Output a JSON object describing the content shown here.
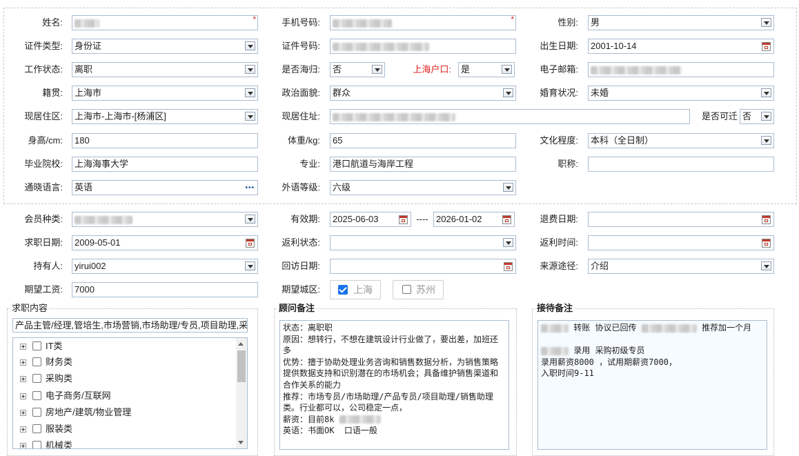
{
  "labels": {
    "name": "姓名:",
    "phone": "手机号码:",
    "gender": "性别:",
    "id_type": "证件类型:",
    "id_no": "证件号码:",
    "birthday": "出生日期:",
    "work_status": "工作状态:",
    "returnee": "是否海归:",
    "shanghai_hukou": "上海户口:",
    "email": "电子邮箱:",
    "native": "籍贯:",
    "political": "政治面貌:",
    "marital": "婚育状况:",
    "residence_area": "现居住区:",
    "residence_addr": "现居住址:",
    "relocate": "是否可迁",
    "height": "身高/cm:",
    "weight": "体重/kg:",
    "education": "文化程度:",
    "school": "毕业院校:",
    "major": "专业:",
    "title": "职称:",
    "language": "通晓语言:",
    "foreign_level": "外语等级:",
    "member_type": "会员种类:",
    "valid_period": "有效期:",
    "period_sep": "----",
    "refund_date": "退费日期:",
    "job_date": "求职日期:",
    "rebate_status": "返利状态:",
    "rebate_time": "返利时间:",
    "holder": "持有人:",
    "visit_date": "回访日期:",
    "source": "来源途径:",
    "expected_salary": "期望工资:",
    "expected_city": "期望城区:"
  },
  "values": {
    "name": "",
    "phone": "",
    "gender": "男",
    "id_type": "身份证",
    "id_no": "",
    "birthday": "2001-10-14",
    "work_status": "离职",
    "returnee": "否",
    "shanghai_hukou": "是",
    "email": "",
    "native": "上海市",
    "political": "群众",
    "marital": "未婚",
    "residence_area": "上海市-上海市-[杨浦区]",
    "residence_addr": "",
    "relocate": "否",
    "height": "180",
    "weight": "65",
    "education": "本科（全日制）",
    "school": "上海海事大学",
    "major": "港口航道与海岸工程",
    "title": "",
    "language": "英语",
    "foreign_level": "六级",
    "member_type": "",
    "valid_from": "2025-06-03",
    "valid_to": "2026-01-02",
    "refund_date": "",
    "job_date": "2009-05-01",
    "rebate_status": "",
    "rebate_time": "",
    "holder": "yirui002",
    "visit_date": "",
    "source": "介绍",
    "expected_salary": "7000"
  },
  "cities": [
    {
      "label": "上海",
      "checked": true
    },
    {
      "label": "苏州",
      "checked": false
    }
  ],
  "job_content": {
    "title": "求职内容",
    "summary": "产品主管/经理,管培生,市场营销,市场助理/专员,项目助理,采购",
    "tree": [
      "IT类",
      "财务类",
      "采购类",
      "电子商务/互联网",
      "房地产/建筑/物业管理",
      "服装类",
      "机械类"
    ]
  },
  "consultant_note": {
    "title": "顾问备注",
    "lines": [
      "状态：离职职",
      "原因：想转行，不想在建筑设计行业做了，要出差，加班还多",
      "优势：擅于协助处理业务咨询和销售数据分析，为销售策略提供数据支持和识别潜在的市场机会；具备维护销售渠道和合作关系的能力",
      "推荐：市场专员/市场助理/产品专员/项目助理/销售助理类。行业都可以，公司稳定一点，",
      "薪资：目前8k",
      "英语：书面OK  口语一般"
    ]
  },
  "reception_note": {
    "title": "接待备注",
    "line1_a": "转账 协议已回传",
    "line1_b": "推荐加一个月",
    "line2": "录用 采购初级专员",
    "line3": "录用薪资8000 ，试用期薪资7000，",
    "line4": "入职时间9-11"
  },
  "colors": {
    "required": "#e02020",
    "hukou_label": "#e02020",
    "checkbox_accent": "#1a73e8",
    "field_border": "#a9bcd0"
  }
}
